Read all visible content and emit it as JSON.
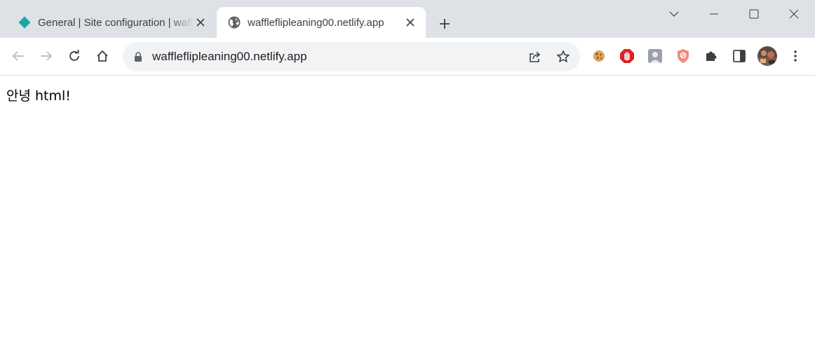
{
  "tabs": [
    {
      "title": "General | Site configuration | waffleflip",
      "favicon": "netlify-diamond-icon",
      "active": false
    },
    {
      "title": "waffleflipleaning00.netlify.app",
      "favicon": "globe-icon",
      "active": true
    }
  ],
  "address_bar": {
    "url": "waffleflipleaning00.netlify.app"
  },
  "page": {
    "greeting": "안녕 html!"
  },
  "colors": {
    "tabbar_bg": "#dee1e6",
    "omnibox_bg": "#f1f3f4",
    "netlify_teal": "#1aa6a6",
    "icon_gray": "#5f6368"
  }
}
